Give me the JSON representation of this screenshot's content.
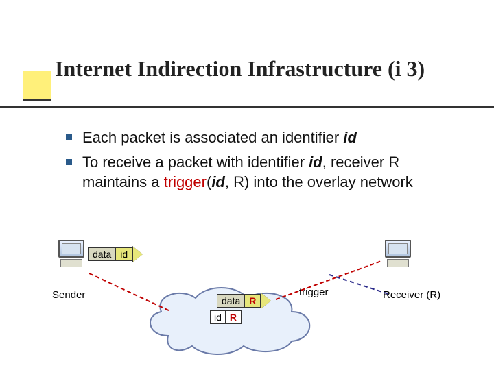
{
  "title": "Internet Indirection Infrastructure (i 3)",
  "bullets": {
    "b1_pre": "Each packet is associated an identifier ",
    "b1_id": "id",
    "b2_pre": "To receive a packet with identifier ",
    "b2_id1": "id",
    "b2_mid": ", receiver R maintains a ",
    "b2_trigger": "trigger",
    "b2_open": "(",
    "b2_id2": "id",
    "b2_post": ", R) into the overlay network"
  },
  "diagram": {
    "sender_label": "Sender",
    "receiver_label": "Receiver (R)",
    "trigger_label": "trigger",
    "packet_data": "data",
    "packet_id": "id",
    "trigger_id": "id",
    "trigger_r": "R",
    "packet2_data": "data",
    "packet2_r": "R"
  }
}
